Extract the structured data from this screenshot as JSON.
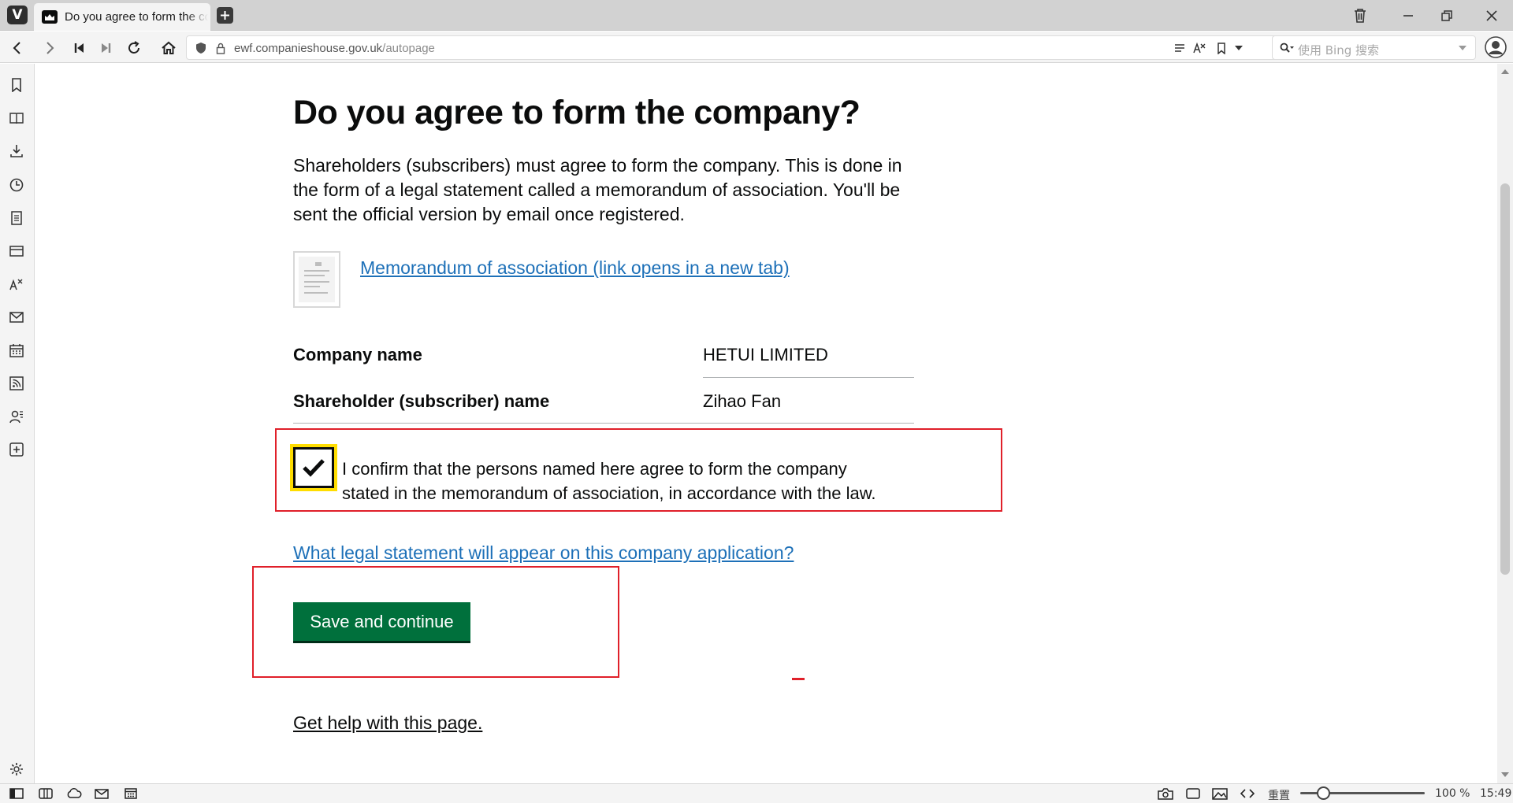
{
  "browser": {
    "tab": {
      "title": "Do you agree to form the company?"
    },
    "address": {
      "host": "ewf.companieshouse.gov.uk",
      "path": "/autopage"
    },
    "search": {
      "placeholder": "使用 Bing 搜索"
    }
  },
  "page": {
    "heading": "Do you agree to form the company?",
    "lead_lines": [
      "Shareholders (subscribers) must agree to form the company. This is done in",
      "the form of a legal statement called a memorandum of association. You'll be",
      "sent the official version by email once registered."
    ],
    "memorandum_link": "Memorandum of association (link opens in a new tab)",
    "summary": [
      {
        "key": "Company name",
        "value": "HETUI LIMITED"
      },
      {
        "key": "Shareholder (subscriber) name",
        "value": "Zihao Fan"
      }
    ],
    "confirm": {
      "checked": true,
      "lines": [
        "I confirm that the persons named here agree to form the company",
        "stated in the memorandum of association, in accordance with the law."
      ]
    },
    "legal_link": "What legal statement will appear on this company application?",
    "save_button": "Save and continue",
    "help_link": "Get help with this page."
  },
  "statusbar": {
    "reset_label": "重置",
    "zoom": "100 %",
    "time": "15:49"
  },
  "colors": {
    "link": "#1d70b8",
    "button": "#00703c",
    "focus": "#ffdd00",
    "annotation": "#e0202a"
  }
}
